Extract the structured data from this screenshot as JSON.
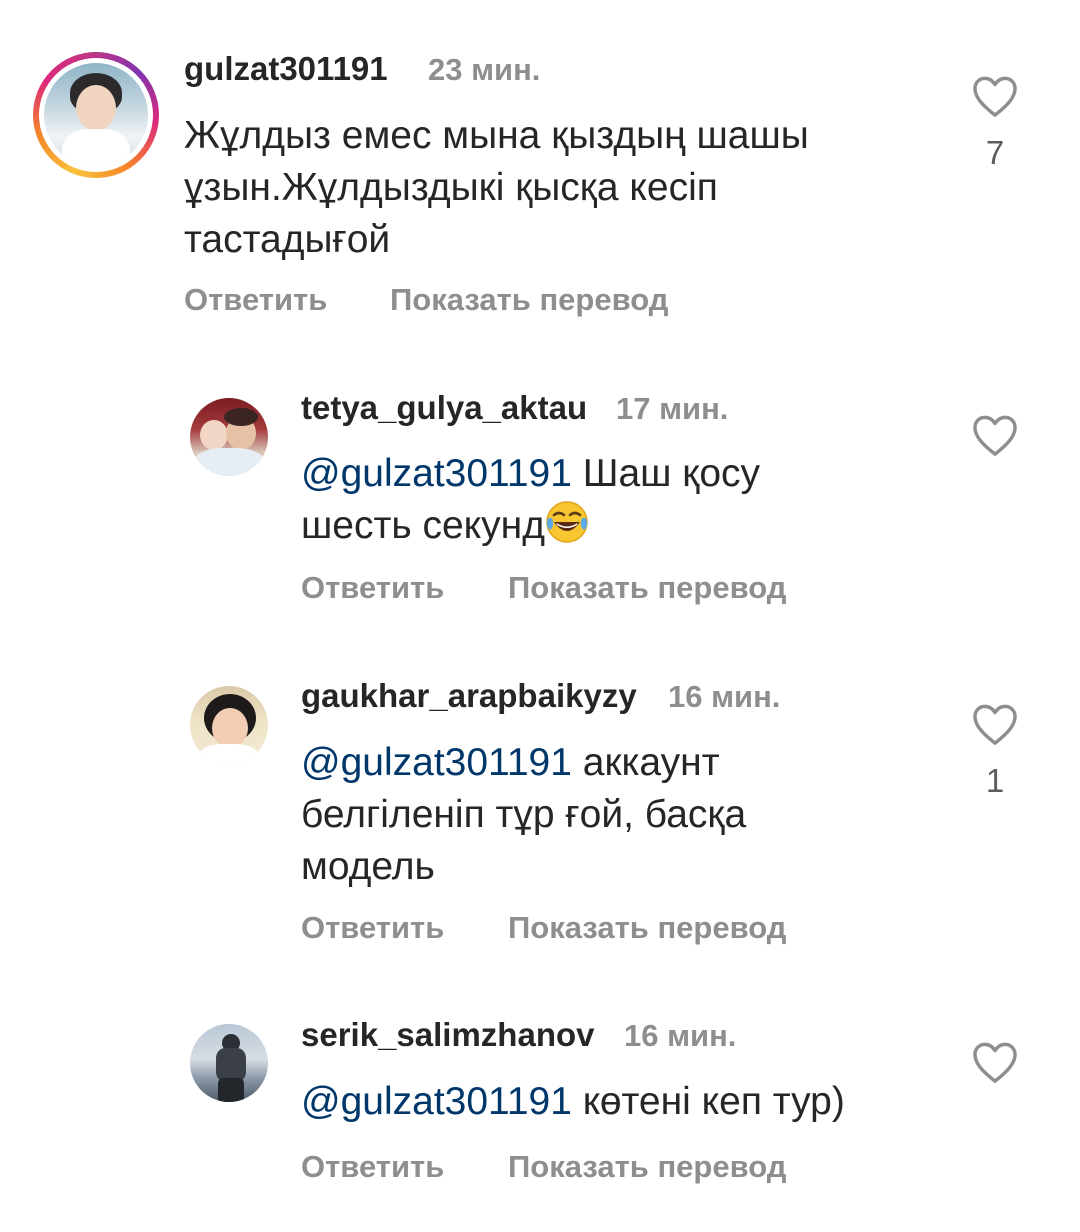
{
  "comments": [
    {
      "username": "gulzat301191",
      "time": "23 мин.",
      "text": "Жұлдыз емес мына қыздың шашы ұзын.Жұлдыздыкі қысқа кесіп тастадығой",
      "text_lines": [
        "Жұлдыз емес мына қыздың шашы",
        "ұзын.Жұлдыздыкі қысқа кесіп",
        "тастадығой"
      ],
      "reply_label": "Ответить",
      "translate_label": "Показать перевод",
      "likes": "7",
      "icon": "heart-outline-icon"
    },
    {
      "username": "tetya_gulya_aktau",
      "time": "17 мин.",
      "mention": "@gulzat301191",
      "text_lines": [
        "Шаш қосу",
        "шесть секунд"
      ],
      "emoji": "face-with-tears-of-joy-icon",
      "reply_label": "Ответить",
      "translate_label": "Показать перевод",
      "likes": "",
      "icon": "heart-outline-icon"
    },
    {
      "username": "gaukhar_arapbaikyzy",
      "time": "16 мин.",
      "mention": "@gulzat301191",
      "text_lines": [
        "аккаунт",
        "белгіленіп тұр ғой, басқа",
        "модель"
      ],
      "reply_label": "Ответить",
      "translate_label": "Показать перевод",
      "likes": "1",
      "icon": "heart-outline-icon"
    },
    {
      "username": "serik_salimzhanov",
      "time": "16 мин.",
      "mention": "@gulzat301191",
      "text_lines": [
        "көтені кеп тур)"
      ],
      "reply_label": "Ответить",
      "translate_label": "Показать перевод",
      "likes": "",
      "icon": "heart-outline-icon"
    }
  ],
  "colors": {
    "text": "#262626",
    "secondary": "#8e8e8e",
    "mention": "#00376b",
    "story_ring_start": "#f9c23c",
    "story_ring_end": "#c13584"
  }
}
